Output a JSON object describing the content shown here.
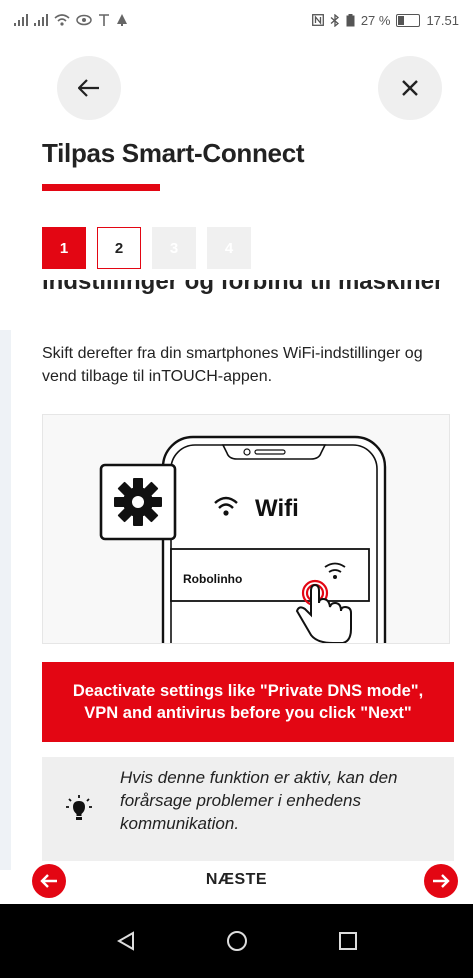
{
  "status_bar": {
    "battery": "27 %",
    "battery_level": 0.27,
    "time": "17.51"
  },
  "header": {
    "title": "Tilpas Smart-Connect",
    "back_icon": "arrow-left-icon",
    "close_icon": "close-icon"
  },
  "steps": [
    "1",
    "2",
    "3",
    "4"
  ],
  "active_step": 1,
  "content": {
    "cut_heading": "indstillinger og forbind til maskinen",
    "body": "Skift derefter fra din smartphones WiFi-indstillinger og vend tilbage til inTOUCH-appen."
  },
  "illustration": {
    "wifi_label": "Wifi",
    "network_name": "Robolinho"
  },
  "warning": {
    "line1": "Deactivate settings like \"Private DNS mode\",",
    "line2": "VPN and antivirus before you click \"Next\""
  },
  "tip": {
    "text": "Hvis denne funktion er aktiv, kan den forårsage problemer i enhedens kommunikation."
  },
  "footer": {
    "next_label": "NÆSTE"
  },
  "colors": {
    "accent": "#e30613",
    "panel": "#efefef"
  }
}
